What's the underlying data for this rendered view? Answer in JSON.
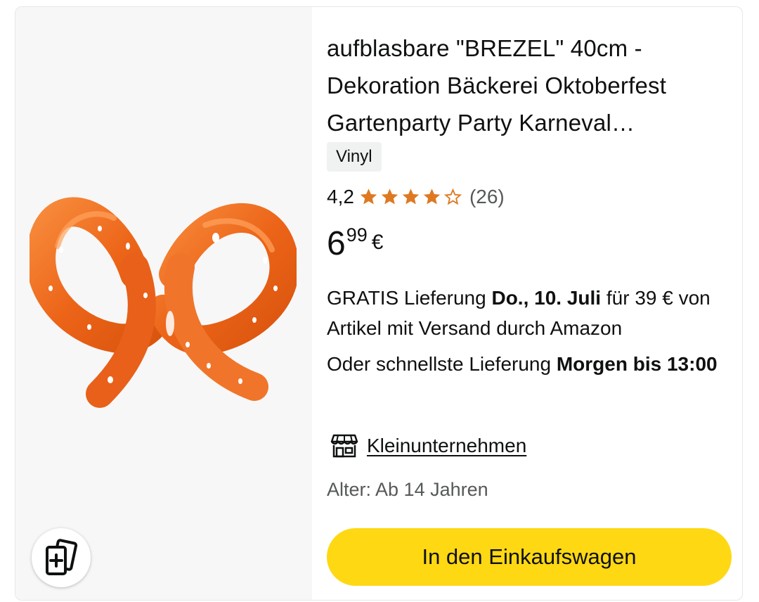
{
  "product": {
    "title": "aufblasbare \"BREZEL\" 40cm - Dekoration Bäckerei Oktoberfest Gartenparty Party Karneval…",
    "material_badge": "Vinyl",
    "image_icon": "pretzel-balloon-image",
    "rating": {
      "value_text": "4,2",
      "stars": 4.2,
      "max_stars": 5,
      "review_count": "(26)"
    },
    "price": {
      "whole": "6",
      "fraction": "99",
      "currency": "€"
    },
    "delivery": {
      "prefix": "GRATIS Lieferung ",
      "date": "Do., 10. Juli",
      "suffix": " für 39 € von Artikel mit Versand durch Amazon"
    },
    "fastest_delivery": {
      "prefix": "Oder schnellste Lieferung ",
      "time": "Morgen bis 13:00"
    },
    "small_business": {
      "icon": "storefront-icon",
      "label": "Kleinunternehmen"
    },
    "age": "Alter: Ab 14 Jahren",
    "cart_button": "In den Einkaufswagen",
    "compare_icon": "compare-cards-icon"
  },
  "colors": {
    "star": "#de7921",
    "cart_button": "#ffd814",
    "image_bg": "#f7f7f7",
    "pretzel": "#f06e1e"
  }
}
